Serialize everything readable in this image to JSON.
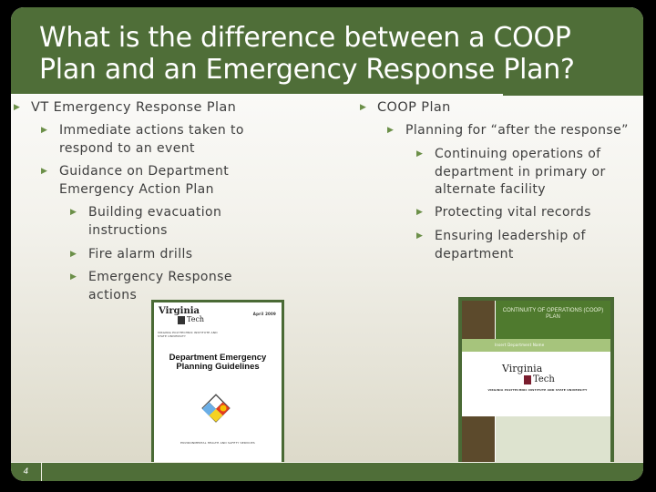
{
  "slide": {
    "title": "What is the difference between a COOP Plan and an Emergency Response Plan?",
    "page_number": "4",
    "colors": {
      "accent_green": "#4f6e38",
      "bullet_arrow": "#6b8f48",
      "text": "#3e3e3e"
    }
  },
  "left_column": {
    "heading": "VT Emergency Response Plan",
    "items": [
      {
        "text": "Immediate actions taken to respond to an event"
      },
      {
        "text": "Guidance on Department Emergency Action Plan",
        "subitems": [
          {
            "text": "Building evacuation instructions"
          },
          {
            "text": "Fire alarm drills"
          },
          {
            "text": "Emergency Response actions"
          }
        ]
      }
    ]
  },
  "right_column": {
    "heading": "COOP Plan",
    "items": [
      {
        "text": "Planning for “after the response”",
        "subitems": [
          {
            "text": "Continuing operations of department in primary or alternate facility"
          },
          {
            "text": "Protecting vital records"
          },
          {
            "text": "Ensuring leadership of department"
          }
        ]
      }
    ]
  },
  "images": {
    "left_doc": {
      "logo_line1": "Virginia",
      "logo_line2": "Tech",
      "date": "April 2009",
      "institution": "VIRGINIA POLYTECHNIC INSTITUTE AND STATE UNIVERSITY",
      "title": "Department Emergency Planning Guidelines",
      "footer": "ENVIRONMENTAL HEALTH AND SAFETY SERVICES"
    },
    "right_doc": {
      "title": "CONTINUITY OF OPERATIONS (COOP) PLAN",
      "subtitle": "Insert Department Name",
      "logo_line1": "Virginia",
      "logo_line2": "Tech",
      "institution": "VIRGINIA POLYTECHNIC INSTITUTE AND STATE UNIVERSITY"
    }
  }
}
